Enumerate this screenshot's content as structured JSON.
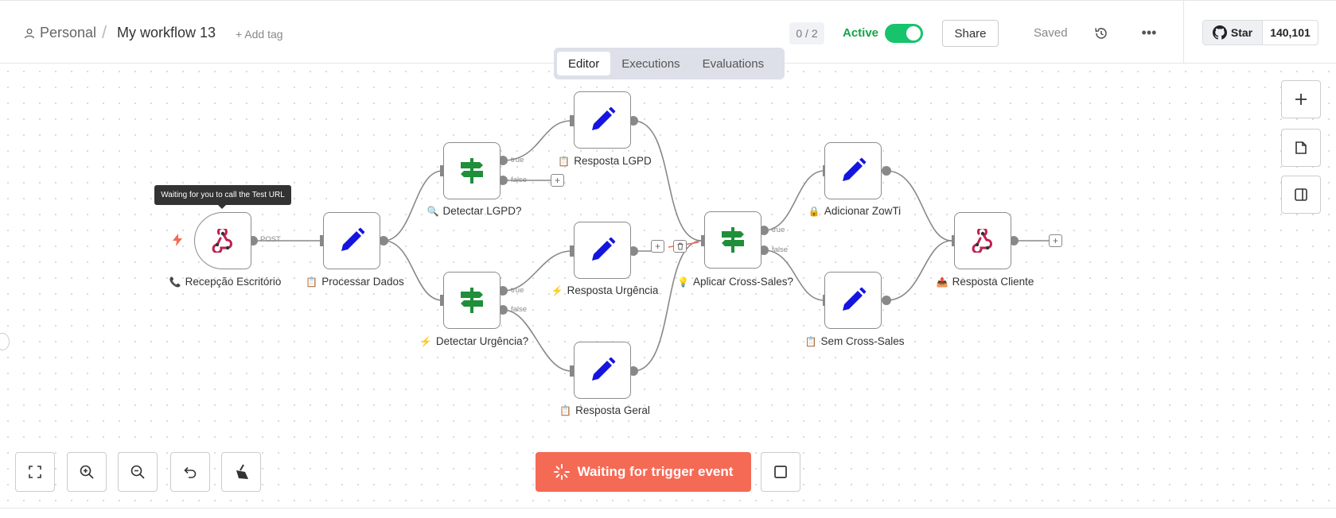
{
  "header": {
    "breadcrumb_project": "Personal",
    "workflow_name": "My workflow 13",
    "add_tag": "+ Add tag",
    "counter": "0 / 2",
    "active_label": "Active",
    "active": true,
    "share_label": "Share",
    "saved_label": "Saved",
    "github_star": "Star",
    "github_count": "140,101"
  },
  "tabs": [
    {
      "label": "Editor",
      "selected": true
    },
    {
      "label": "Executions",
      "selected": false
    },
    {
      "label": "Evaluations",
      "selected": false
    }
  ],
  "tooltip": "Waiting for you to call the Test URL",
  "nodes": {
    "recepcao": {
      "label": "Recepção Escritório",
      "emoji": "📞",
      "icon": "webhook-icon"
    },
    "processar": {
      "label": "Processar Dados",
      "emoji": "📋",
      "icon": "pencil-icon"
    },
    "detectar_lgpd": {
      "label": "Detectar LGPD?",
      "emoji": "🔍",
      "icon": "signpost-icon"
    },
    "detectar_urgencia": {
      "label": "Detectar Urgência?",
      "emoji": "⚡",
      "icon": "signpost-icon"
    },
    "resposta_lgpd": {
      "label": "Resposta LGPD",
      "emoji": "📋",
      "icon": "pencil-icon"
    },
    "resposta_urgencia": {
      "label": "Resposta Urgência",
      "emoji": "⚡",
      "icon": "pencil-icon"
    },
    "resposta_geral": {
      "label": "Resposta Geral",
      "emoji": "📋",
      "icon": "pencil-icon"
    },
    "aplicar_cross": {
      "label": "Aplicar Cross-Sales?",
      "emoji": "💡",
      "icon": "signpost-icon"
    },
    "adicionar_zowti": {
      "label": "Adicionar ZowTi",
      "emoji": "🔒",
      "icon": "pencil-icon"
    },
    "sem_cross": {
      "label": "Sem Cross-Sales",
      "emoji": "📋",
      "icon": "pencil-icon"
    },
    "resposta_cliente": {
      "label": "Resposta Cliente",
      "emoji": "📤",
      "icon": "webhook-icon"
    }
  },
  "port_labels": {
    "post": "POST",
    "true": "true",
    "false": "false"
  },
  "controls": {
    "waiting_label": "Waiting for trigger event"
  },
  "colors": {
    "accent": "#f56a55",
    "active_green": "#17c46b",
    "pencil_blue": "#1515e0",
    "signpost_green": "#1f8f3a",
    "webhook_red": "#c0204f"
  }
}
